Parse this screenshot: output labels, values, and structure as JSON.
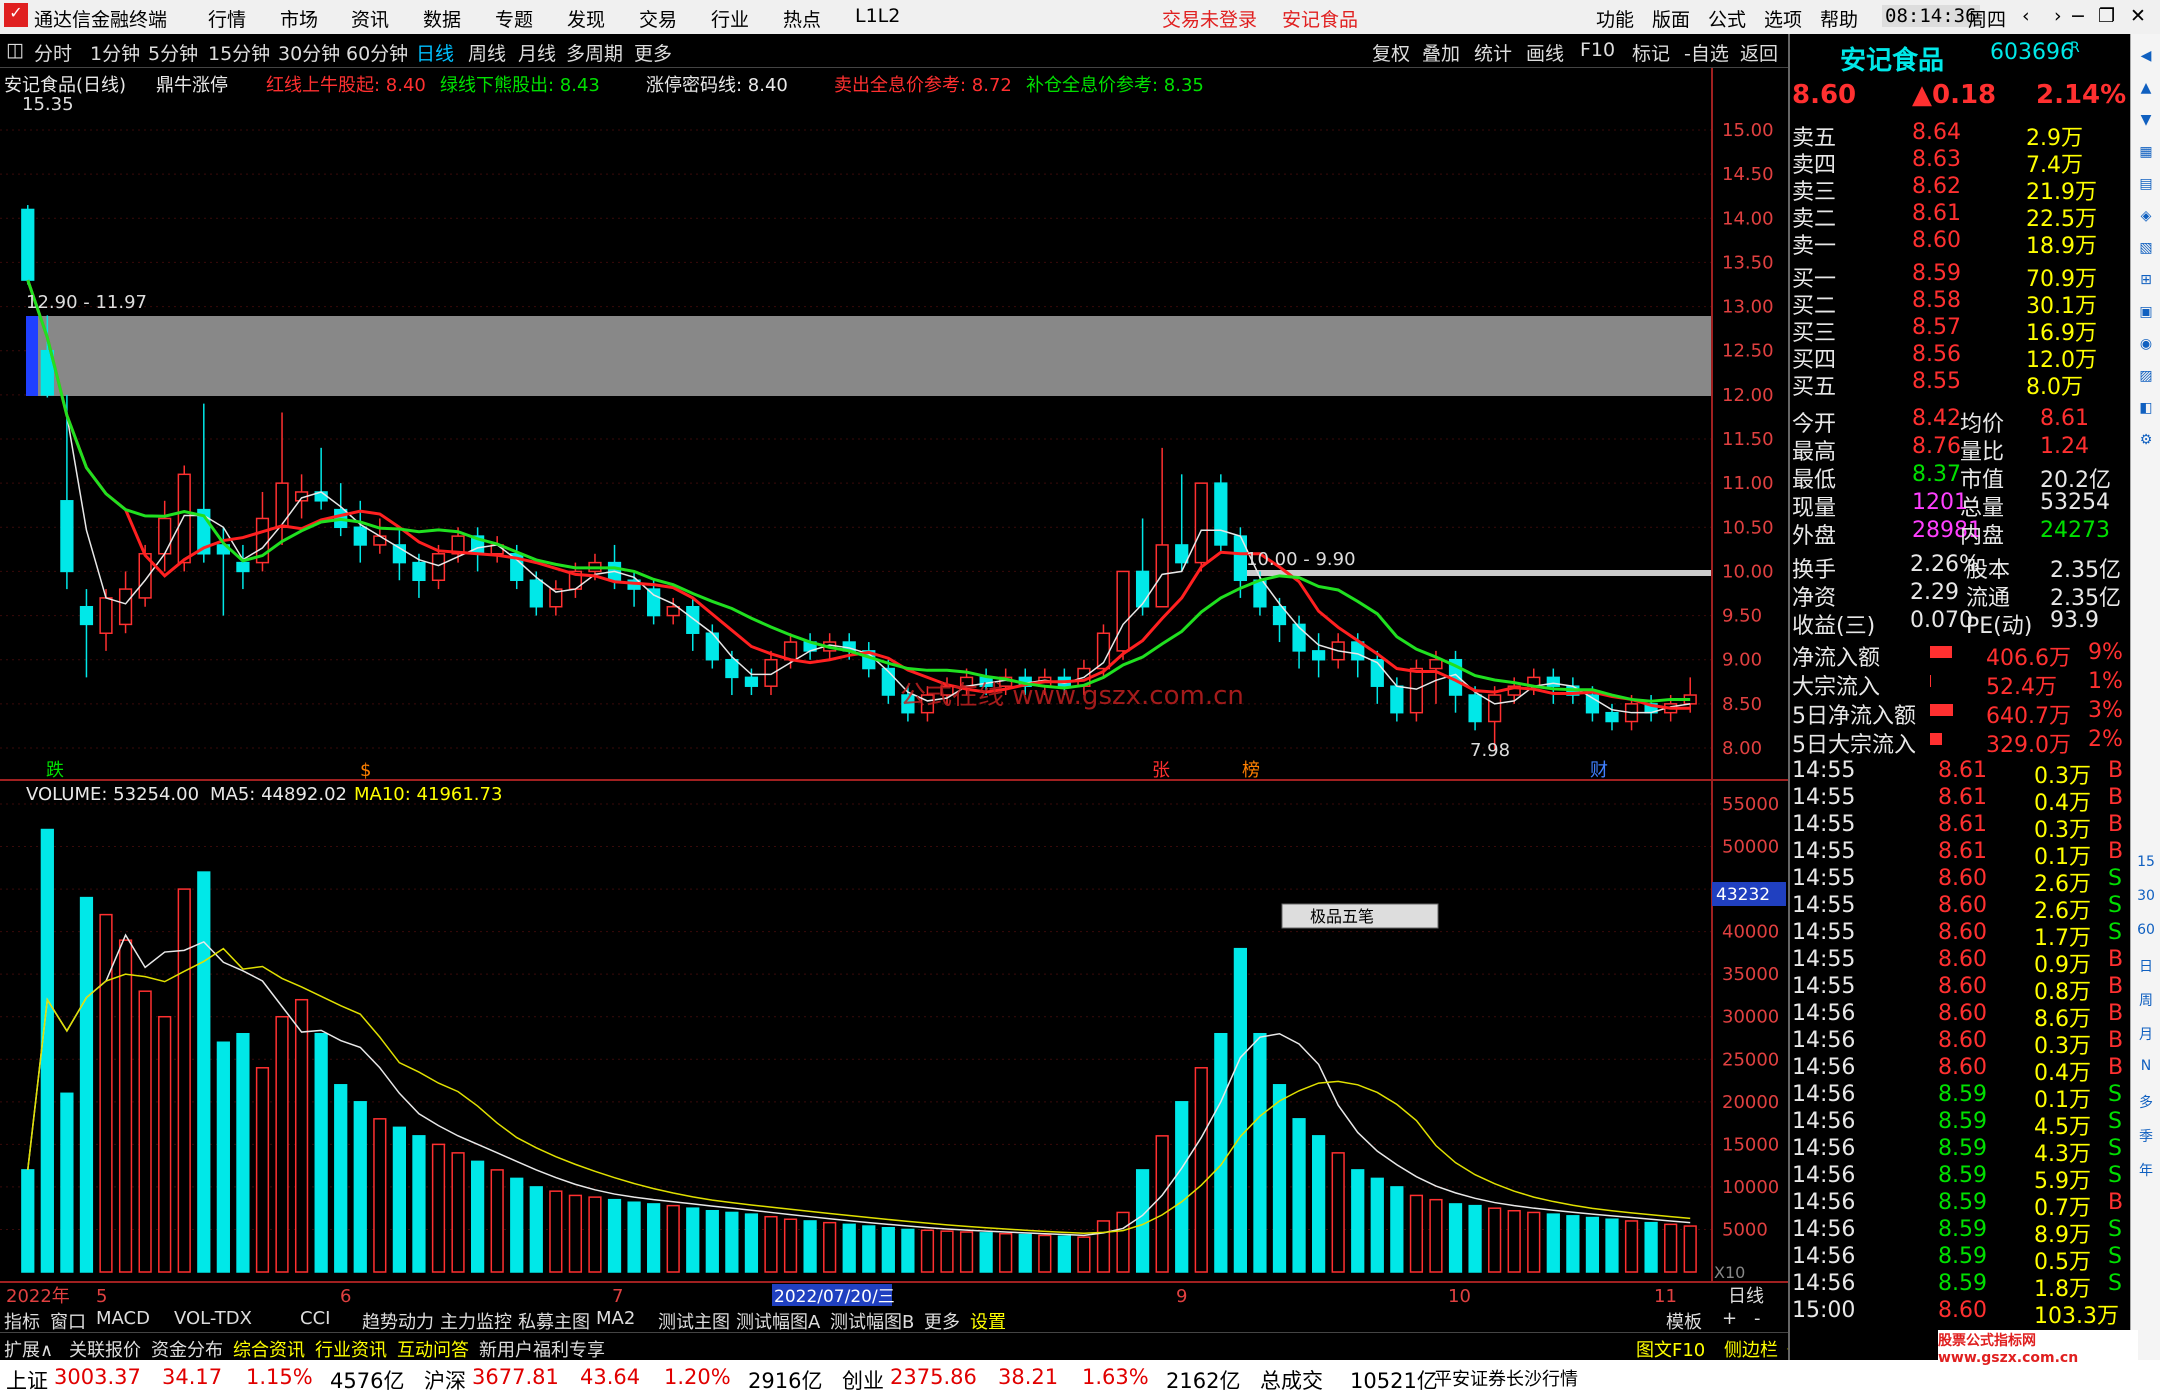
{
  "app": {
    "title": "通达信金融终端",
    "menus": [
      "行情",
      "市场",
      "资讯",
      "数据",
      "专题",
      "发现",
      "交易",
      "行业",
      "热点",
      "L1L2"
    ],
    "login_status": "交易未登录",
    "stock_title": "安记食品",
    "right_menus": [
      "功能",
      "版面",
      "公式",
      "选项",
      "帮助"
    ],
    "time": "08:14:36",
    "weekday": "周四"
  },
  "toolbar": {
    "periods": [
      "分时",
      "1分钟",
      "5分钟",
      "15分钟",
      "30分钟",
      "60分钟",
      "日线",
      "周线",
      "月线",
      "多周期",
      "更多"
    ],
    "active": "日线",
    "right_buttons": [
      "复权",
      "叠加",
      "统计",
      "画线",
      "F10",
      "标记",
      "-自选",
      "返回"
    ]
  },
  "indicator": {
    "name": "安记食品(日线)",
    "formula": "鼎牛涨停",
    "items": [
      {
        "label": "红线上牛股起:",
        "value": "8.40",
        "color": "#ff3030"
      },
      {
        "label": "绿线下熊股出:",
        "value": "8.43",
        "color": "#00e000"
      },
      {
        "label": "涨停密码线:",
        "value": "8.40",
        "color": "#e8e8e8"
      },
      {
        "label": "卖出全息价参考:",
        "value": "8.72",
        "color": "#ff3030"
      },
      {
        "label": "补仓全息价参考:",
        "value": "8.35",
        "color": "#00e000"
      }
    ]
  },
  "chart_annotations": {
    "high_label": "15.35",
    "range1": "12.90 - 11.97",
    "range2": "10.00 - 9.90",
    "low_label": "7.98",
    "watermark": "公式在线 www.gszx.com.cn",
    "markers": [
      "跌",
      "$",
      "张",
      "榜",
      "财"
    ]
  },
  "volume": {
    "label": "VOLUME: 53254.00",
    "ma5": "MA5: 44892.02",
    "ma10": "MA10: 41961.73",
    "current_tag": "43232",
    "x10": "X10"
  },
  "price_axis": [
    "15.00",
    "14.50",
    "14.00",
    "13.50",
    "13.00",
    "12.50",
    "12.00",
    "11.50",
    "11.00",
    "10.50",
    "10.00",
    "9.50",
    "9.00",
    "8.50",
    "8.00"
  ],
  "volume_axis": [
    "55000",
    "50000",
    "45000",
    "40000",
    "35000",
    "30000",
    "25000",
    "20000",
    "15000",
    "10000",
    "5000"
  ],
  "date_axis": [
    {
      "label": "2022年"
    },
    {
      "label": "5"
    },
    {
      "label": "6"
    },
    {
      "label": "7"
    },
    {
      "label": "2022/07/20/三"
    },
    {
      "label": "9"
    },
    {
      "label": "10"
    },
    {
      "label": "11"
    }
  ],
  "period_label": "日线",
  "popup": {
    "label": "极品五笔"
  },
  "chart_data": {
    "type": "candlestick",
    "symbol": "603696",
    "high": 15.35,
    "low": 7.98,
    "ylim": [
      8.0,
      15.0
    ],
    "vol_ylim": [
      0,
      55000
    ],
    "candles": [
      [
        14.1,
        13.3,
        14.15,
        13.25
      ],
      [
        12.5,
        12.0,
        12.9,
        11.97
      ],
      [
        10.8,
        10.0,
        12.0,
        9.8
      ],
      [
        9.6,
        9.4,
        9.8,
        8.8
      ],
      [
        9.3,
        9.7,
        9.8,
        9.1
      ],
      [
        9.4,
        9.8,
        10.0,
        9.3
      ],
      [
        9.7,
        10.2,
        10.3,
        9.6
      ],
      [
        10.2,
        10.6,
        10.8,
        10.0
      ],
      [
        10.1,
        11.1,
        11.2,
        10.0
      ],
      [
        10.7,
        10.2,
        11.9,
        10.1
      ],
      [
        10.3,
        10.2,
        10.5,
        9.5
      ],
      [
        10.1,
        10.0,
        10.3,
        9.8
      ],
      [
        10.1,
        10.6,
        10.9,
        10.0
      ],
      [
        10.5,
        11.0,
        11.8,
        10.3
      ],
      [
        10.8,
        10.9,
        11.1,
        10.6
      ],
      [
        10.9,
        10.8,
        11.4,
        10.7
      ],
      [
        10.7,
        10.5,
        11.0,
        10.4
      ],
      [
        10.5,
        10.3,
        10.8,
        10.1
      ],
      [
        10.3,
        10.4,
        10.6,
        10.2
      ],
      [
        10.3,
        10.1,
        10.5,
        9.9
      ],
      [
        10.1,
        9.9,
        10.2,
        9.7
      ],
      [
        9.9,
        10.2,
        10.3,
        9.8
      ],
      [
        10.2,
        10.4,
        10.5,
        10.1
      ],
      [
        10.4,
        10.2,
        10.5,
        10.0
      ],
      [
        10.2,
        10.3,
        10.4,
        10.1
      ],
      [
        10.2,
        9.9,
        10.3,
        9.8
      ],
      [
        9.9,
        9.6,
        10.0,
        9.5
      ],
      [
        9.6,
        9.8,
        9.9,
        9.5
      ],
      [
        9.8,
        10.0,
        10.1,
        9.7
      ],
      [
        10.0,
        10.1,
        10.2,
        9.9
      ],
      [
        10.1,
        9.9,
        10.3,
        9.8
      ],
      [
        9.9,
        9.8,
        10.0,
        9.6
      ],
      [
        9.8,
        9.5,
        9.9,
        9.4
      ],
      [
        9.5,
        9.6,
        9.7,
        9.4
      ],
      [
        9.6,
        9.3,
        9.7,
        9.1
      ],
      [
        9.3,
        9.0,
        9.4,
        8.9
      ],
      [
        9.0,
        8.8,
        9.1,
        8.6
      ],
      [
        8.8,
        8.7,
        8.9,
        8.6
      ],
      [
        8.7,
        9.0,
        9.1,
        8.6
      ],
      [
        9.0,
        9.2,
        9.3,
        8.9
      ],
      [
        9.2,
        9.1,
        9.3,
        9.0
      ],
      [
        9.1,
        9.2,
        9.3,
        9.0
      ],
      [
        9.2,
        9.1,
        9.3,
        9.0
      ],
      [
        9.1,
        8.9,
        9.2,
        8.8
      ],
      [
        8.9,
        8.6,
        9.0,
        8.5
      ],
      [
        8.6,
        8.4,
        8.7,
        8.3
      ],
      [
        8.4,
        8.6,
        8.7,
        8.3
      ],
      [
        8.6,
        8.7,
        8.8,
        8.5
      ],
      [
        8.7,
        8.8,
        8.9,
        8.6
      ],
      [
        8.8,
        8.7,
        8.9,
        8.6
      ],
      [
        8.7,
        8.8,
        8.9,
        8.6
      ],
      [
        8.8,
        8.7,
        8.9,
        8.6
      ],
      [
        8.7,
        8.8,
        8.9,
        8.6
      ],
      [
        8.8,
        8.7,
        8.9,
        8.6
      ],
      [
        8.7,
        8.9,
        9.0,
        8.6
      ],
      [
        8.9,
        9.3,
        9.4,
        8.8
      ],
      [
        9.1,
        10.0,
        10.0,
        9.0
      ],
      [
        10.0,
        9.6,
        10.6,
        9.5
      ],
      [
        9.6,
        10.3,
        11.4,
        9.6
      ],
      [
        10.3,
        10.1,
        11.1,
        10.0
      ],
      [
        10.1,
        11.0,
        11.0,
        10.0
      ],
      [
        11.0,
        10.3,
        11.1,
        10.2
      ],
      [
        10.4,
        9.9,
        10.5,
        9.7
      ],
      [
        9.9,
        9.6,
        10.0,
        9.5
      ],
      [
        9.6,
        9.4,
        9.7,
        9.2
      ],
      [
        9.4,
        9.1,
        9.5,
        8.9
      ],
      [
        9.1,
        9.0,
        9.3,
        8.8
      ],
      [
        9.0,
        9.2,
        9.3,
        8.9
      ],
      [
        9.2,
        9.0,
        9.3,
        8.8
      ],
      [
        9.0,
        8.7,
        9.1,
        8.5
      ],
      [
        8.7,
        8.4,
        8.8,
        8.3
      ],
      [
        8.4,
        8.9,
        9.0,
        8.3
      ],
      [
        8.9,
        9.0,
        9.1,
        8.5
      ],
      [
        9.0,
        8.6,
        9.1,
        8.4
      ],
      [
        8.6,
        8.3,
        8.7,
        8.2
      ],
      [
        8.3,
        8.6,
        8.7,
        7.98
      ],
      [
        8.6,
        8.7,
        8.8,
        8.5
      ],
      [
        8.7,
        8.8,
        8.9,
        8.6
      ],
      [
        8.8,
        8.7,
        8.9,
        8.5
      ],
      [
        8.7,
        8.6,
        8.8,
        8.5
      ],
      [
        8.6,
        8.4,
        8.7,
        8.3
      ],
      [
        8.4,
        8.3,
        8.5,
        8.2
      ],
      [
        8.3,
        8.5,
        8.6,
        8.2
      ],
      [
        8.5,
        8.4,
        8.6,
        8.3
      ],
      [
        8.4,
        8.5,
        8.6,
        8.3
      ],
      [
        8.5,
        8.6,
        8.8,
        8.4
      ]
    ],
    "volumes": [
      12000,
      52000,
      21000,
      44000,
      42000,
      39000,
      33000,
      30000,
      45000,
      47000,
      27000,
      28000,
      24000,
      30000,
      32000,
      28000,
      22000,
      20000,
      18000,
      17000,
      16000,
      15000,
      14000,
      13000,
      12000,
      11000,
      10000,
      9500,
      9000,
      8800,
      8500,
      8200,
      8000,
      7800,
      7500,
      7200,
      7000,
      6800,
      6500,
      6200,
      6000,
      5800,
      5600,
      5400,
      5200,
      5000,
      4900,
      4800,
      4700,
      4600,
      4500,
      4400,
      4300,
      4200,
      4100,
      6000,
      7000,
      12000,
      16000,
      20000,
      24000,
      28000,
      38000,
      28000,
      22000,
      18000,
      16000,
      14000,
      12000,
      11000,
      10000,
      9000,
      8500,
      8000,
      7800,
      7500,
      7200,
      7000,
      6800,
      6600,
      6400,
      6200,
      6000,
      5800,
      5600,
      5400
    ]
  },
  "quote": {
    "name": "安记食品",
    "code": "603696",
    "suffix": "R",
    "price": "8.60",
    "change": "▲0.18",
    "pct": "2.14%",
    "sells": [
      {
        "label": "卖五",
        "price": "8.64",
        "vol": "2.9万"
      },
      {
        "label": "卖四",
        "price": "8.63",
        "vol": "7.4万"
      },
      {
        "label": "卖三",
        "price": "8.62",
        "vol": "21.9万"
      },
      {
        "label": "卖二",
        "price": "8.61",
        "vol": "22.5万"
      },
      {
        "label": "卖一",
        "price": "8.60",
        "vol": "18.9万"
      }
    ],
    "buys": [
      {
        "label": "买一",
        "price": "8.59",
        "vol": "70.9万"
      },
      {
        "label": "买二",
        "price": "8.58",
        "vol": "30.1万"
      },
      {
        "label": "买三",
        "price": "8.57",
        "vol": "16.9万"
      },
      {
        "label": "买四",
        "price": "8.56",
        "vol": "12.0万"
      },
      {
        "label": "买五",
        "price": "8.55",
        "vol": "8.0万"
      }
    ],
    "stats": [
      {
        "l1": "今开",
        "v1": "8.42",
        "l2": "均价",
        "v2": "8.61"
      },
      {
        "l1": "最高",
        "v1": "8.76",
        "l2": "量比",
        "v2": "1.24"
      },
      {
        "l1": "最低",
        "v1": "8.37",
        "l2": "市值",
        "v2": "20.2亿"
      },
      {
        "l1": "现量",
        "v1": "1201",
        "l2": "总量",
        "v2": "53254"
      },
      {
        "l1": "外盘",
        "v1": "28981",
        "l2": "内盘",
        "v2": "24273"
      }
    ],
    "stats2": [
      {
        "l1": "换手",
        "v1": "2.26%",
        "l2": "股本",
        "v2": "2.35亿"
      },
      {
        "l1": "净资",
        "v1": "2.29",
        "l2": "流通",
        "v2": "2.35亿"
      },
      {
        "l1": "收益(三)",
        "v1": "0.070",
        "l2": "PE(动)",
        "v2": "93.9"
      }
    ],
    "flows": [
      {
        "label": "净流入额",
        "value": "406.6万",
        "pct": "9%",
        "bar": 0.9
      },
      {
        "label": "大宗流入",
        "value": "52.4万",
        "pct": "1%",
        "bar": 0.05
      },
      {
        "label": "5日净流入额",
        "value": "640.7万",
        "pct": "3%",
        "bar": 0.95
      },
      {
        "label": "5日大宗流入",
        "value": "329.0万",
        "pct": "2%",
        "bar": 0.5
      }
    ],
    "ticks": [
      [
        "14:55",
        "8.61",
        "0.3万",
        "B"
      ],
      [
        "14:55",
        "8.61",
        "0.4万",
        "B"
      ],
      [
        "14:55",
        "8.61",
        "0.3万",
        "B"
      ],
      [
        "14:55",
        "8.61",
        "0.1万",
        "B"
      ],
      [
        "14:55",
        "8.60",
        "2.6万",
        "S"
      ],
      [
        "14:55",
        "8.60",
        "2.6万",
        "S"
      ],
      [
        "14:55",
        "8.60",
        "1.7万",
        "S"
      ],
      [
        "14:55",
        "8.60",
        "0.9万",
        "B"
      ],
      [
        "14:55",
        "8.60",
        "0.8万",
        "B"
      ],
      [
        "14:56",
        "8.60",
        "8.6万",
        "B"
      ],
      [
        "14:56",
        "8.60",
        "0.3万",
        "B"
      ],
      [
        "14:56",
        "8.60",
        "0.4万",
        "B"
      ],
      [
        "14:56",
        "8.59",
        "0.1万",
        "S"
      ],
      [
        "14:56",
        "8.59",
        "4.5万",
        "S"
      ],
      [
        "14:56",
        "8.59",
        "4.3万",
        "S"
      ],
      [
        "14:56",
        "8.59",
        "5.9万",
        "S"
      ],
      [
        "14:56",
        "8.59",
        "0.7万",
        "B"
      ],
      [
        "14:56",
        "8.59",
        "8.9万",
        "S"
      ],
      [
        "14:56",
        "8.59",
        "0.5万",
        "S"
      ],
      [
        "14:56",
        "8.59",
        "1.8万",
        "S"
      ],
      [
        "15:00",
        "8.60",
        "103.3万",
        ""
      ]
    ]
  },
  "bottom_tabs": [
    "指标",
    "窗口",
    "MACD",
    "VOL-TDX",
    "CCI",
    "趋势动力",
    "主力监控",
    "私募主图",
    "MA2",
    "测试主图",
    "测试幅图A",
    "测试幅图B",
    "更多",
    "设置"
  ],
  "bottom_tabs_right": [
    "模板",
    "+",
    "-"
  ],
  "info_tabs": [
    "扩展∧",
    "关联报价",
    "资金分布",
    "综合资讯",
    "行业资讯",
    "互动问答",
    "新用户福利专享"
  ],
  "info_right": [
    "图文F10",
    "侧边栏《",
    "笔",
    "价",
    "细",
    "势",
    "联"
  ],
  "status": [
    {
      "name": "上证",
      "v": "3003.37",
      "c": "34.17",
      "p": "1.15%",
      "a": "4576亿"
    },
    {
      "name": "沪深",
      "v": "3677.81",
      "c": "43.64",
      "p": "1.20%",
      "a": "2916亿"
    },
    {
      "name": "创业",
      "v": "2375.86",
      "c": "38.21",
      "p": "1.63%",
      "a": "2162亿"
    }
  ],
  "status_total": {
    "label": "总成交",
    "value": "10521亿",
    "broker": "平安证券长沙行情"
  },
  "watermark2": "股票公式指标网 www.gszx.com.cn",
  "sidebar_labels": [
    "15",
    "30",
    "60",
    "日",
    "周",
    "月",
    "N",
    "多",
    "季",
    "年"
  ]
}
